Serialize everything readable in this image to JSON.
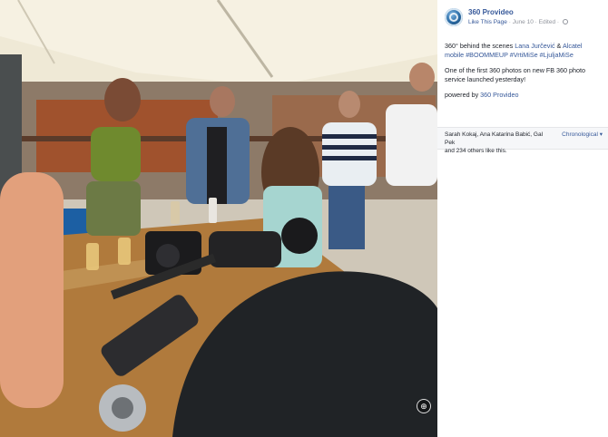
{
  "page": {
    "name": "360 Provideo",
    "like_label": "Like This Page",
    "date": "June 10",
    "edited": "Edited"
  },
  "post": {
    "line1_prefix": "360° behind the scenes ",
    "mention1": "Lana Jurčević",
    "amp": " & ",
    "mention2": "Alcatel mobile",
    "hashtags": "#BOOMMEUP #VrtiMiSe #LjuljaMiSe",
    "paragraph2": "One of the first 360 photos on new FB 360 photo service launched yesterday!",
    "powered_prefix": "powered by ",
    "powered_link": "360 Provideo"
  },
  "likes": {
    "names": "Sarah Kokaj, Ana Katarina Babić, Gal Pek",
    "others": "and 234 others like this.",
    "sort_label": "Chronological ▾"
  },
  "icons": {
    "avatar": "360-provideo-logo",
    "globe": "globe-icon",
    "compass": "360-compass-icon"
  },
  "colors": {
    "link": "#365899",
    "meta": "#90949c"
  }
}
